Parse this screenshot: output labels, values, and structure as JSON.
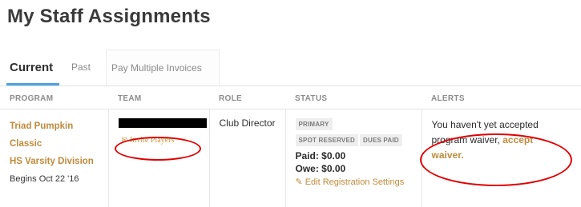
{
  "page": {
    "title": "My Staff Assignments"
  },
  "tabs": [
    {
      "label": "Current",
      "active": true
    },
    {
      "label": "Past",
      "active": false
    },
    {
      "label": "Pay Multiple Invoices",
      "active": false
    }
  ],
  "table": {
    "headers": [
      "PROGRAM",
      "TEAM",
      "ROLE",
      "STATUS",
      "ALERTS"
    ],
    "rows": [
      {
        "program": {
          "name_line1": "Triad Pumpkin Classic",
          "name_line2": "HS Varsity Division",
          "date": "Begins Oct 22 '16"
        },
        "team": {
          "name_redacted": true,
          "invite_label": "Invite Players",
          "invite_icon": "envelope-icon"
        },
        "role": "Club Director",
        "status": {
          "badges": [
            "PRIMARY",
            "SPOT RESERVED",
            "DUES PAID"
          ],
          "paid": "Paid: $0.00",
          "owe": "Owe: $0.00",
          "edit_label": "Edit Registration Settings",
          "edit_icon": "pencil-edit-icon"
        },
        "alerts": {
          "text": "You haven't yet accepted program waiver,",
          "link": "accept waiver."
        }
      }
    ]
  },
  "colors": {
    "accent": "#c08a3a",
    "tab_underline": "#4aa3df",
    "annotation": "#e00000"
  }
}
